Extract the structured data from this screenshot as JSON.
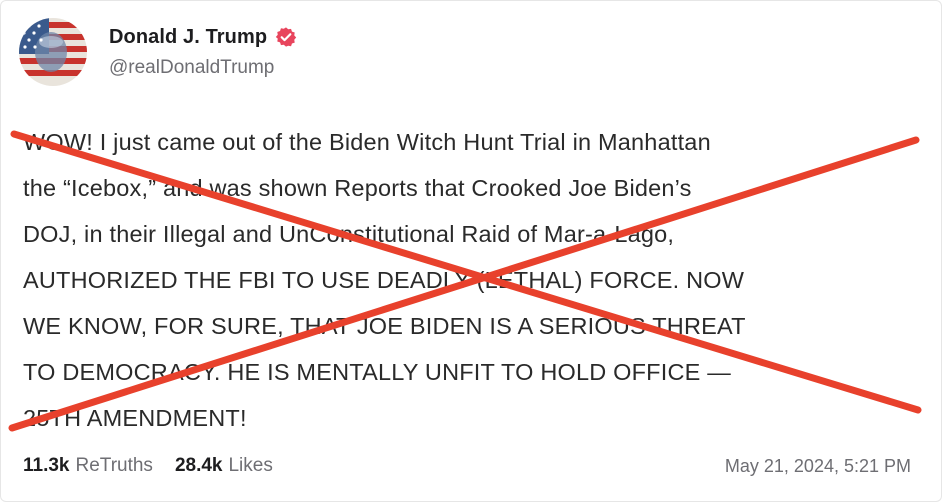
{
  "post": {
    "author": {
      "display_name": "Donald J. Trump",
      "handle": "@realDonaldTrump",
      "verified_icon": "verified-badge-icon",
      "avatar_icon": "flag-portrait-avatar"
    },
    "text": "WOW! I just came out of the Biden Witch Hunt Trial in Manhattan\nthe “Icebox,” and was shown Reports that Crooked Joe Biden’s\nDOJ, in their Illegal and UnConstitutional Raid of Mar-a-Lago,\nAUTHORIZED THE FBI TO USE DEADLY (LETHAL) FORCE. NOW\nWE KNOW, FOR SURE, THAT JOE BIDEN IS A SERIOUS THREAT\nTO DEMOCRACY. HE IS MENTALLY UNFIT TO HOLD OFFICE —\n25TH AMENDMENT!",
    "stats": {
      "retruths_count": "11.3k",
      "retruths_label": "ReTruths",
      "likes_count": "28.4k",
      "likes_label": "Likes"
    },
    "timestamp": "May 21, 2024, 5:21 PM"
  },
  "overlay": {
    "type": "red-x-cross",
    "color": "#e8412c"
  }
}
